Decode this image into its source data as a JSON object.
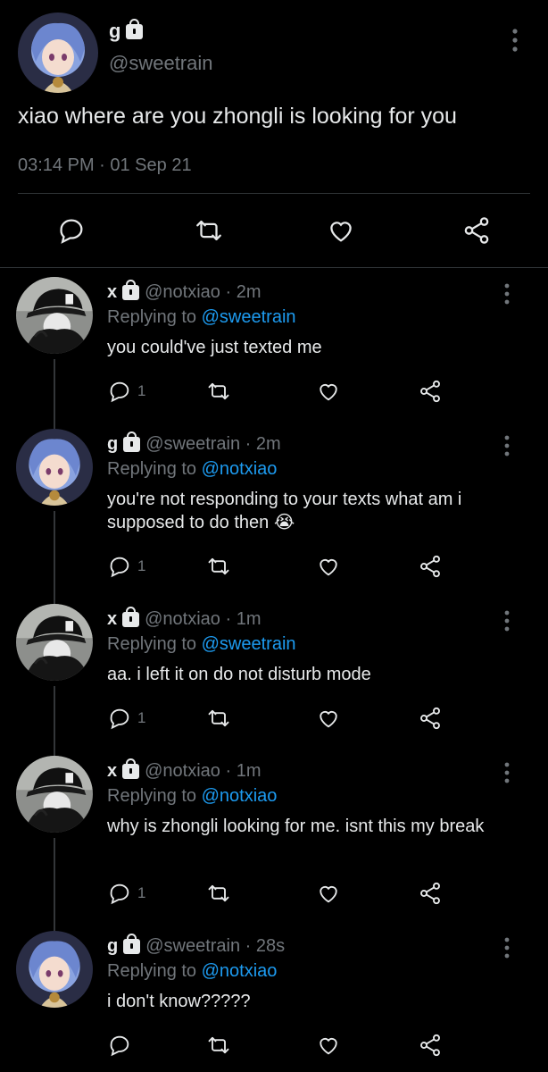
{
  "main_tweet": {
    "name": "g",
    "handle": "@sweetrain",
    "text": "xiao where are you zhongli is looking for you",
    "timestamp": "03:14 PM · 01 Sep 21"
  },
  "replies": [
    {
      "name": "x",
      "handle": "@notxiao · 2m",
      "replying_prefix": "Replying to",
      "replying_to": "@sweetrain",
      "text": "you could've just texted me",
      "reply_count": "1",
      "avatar": "black-cap"
    },
    {
      "name": "g",
      "handle": "@sweetrain · 2m",
      "replying_prefix": "Replying to",
      "replying_to": "@notxiao",
      "text": "you're not responding to your texts what am i supposed to do then 😭",
      "reply_count": "1",
      "avatar": "anime"
    },
    {
      "name": "x",
      "handle": "@notxiao · 1m",
      "replying_prefix": "Replying to",
      "replying_to": "@sweetrain",
      "text": "aa. i left it on do not disturb mode",
      "reply_count": "1",
      "avatar": "black-cap"
    },
    {
      "name": "x",
      "handle": "@notxiao · 1m",
      "replying_prefix": "Replying to",
      "replying_to": "@notxiao",
      "text": "why is zhongli looking for me. isnt this my break",
      "reply_count": "1",
      "avatar": "black-cap"
    },
    {
      "name": "g",
      "handle": "@sweetrain · 28s",
      "replying_prefix": "Replying to",
      "replying_to": "@notxiao",
      "text": "i don't know?????",
      "reply_count": "",
      "avatar": "anime"
    }
  ],
  "colors": {
    "background": "#000000",
    "text": "#e7e9ea",
    "secondary": "#71767b",
    "link": "#1d9bf0",
    "divider": "#2f3336"
  },
  "icons": [
    "lock-icon",
    "more-icon",
    "reply-icon",
    "retweet-icon",
    "like-icon",
    "share-icon"
  ]
}
